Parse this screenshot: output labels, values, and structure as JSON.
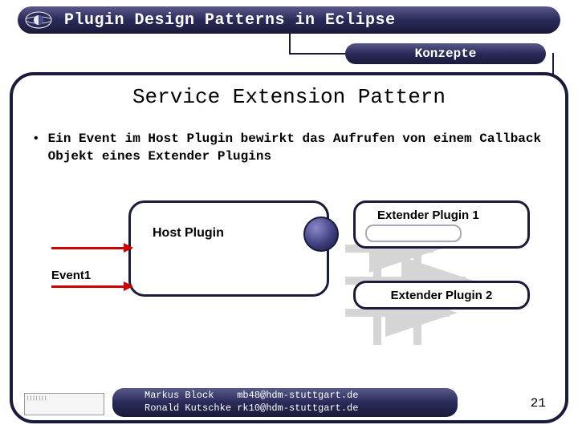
{
  "header": {
    "title": "Plugin Design Patterns in Eclipse"
  },
  "subheader": {
    "label": "Konzepte"
  },
  "slide": {
    "title": "Service Extension Pattern",
    "bullet1": "Ein Event im Host Plugin bewirkt das Aufrufen von einem Callback Objekt eines Extender Plugins"
  },
  "diagram": {
    "host_label": "Host Plugin",
    "ext1_label": "Extender Plugin 1",
    "ext2_label": "Extender Plugin 2",
    "event_label": "Event1"
  },
  "footer": {
    "line1": "Markus Block    mb48@hdm-stuttgart.de",
    "line2": "Ronald Kutschke rk10@hdm-stuttgart.de",
    "page": "21"
  }
}
